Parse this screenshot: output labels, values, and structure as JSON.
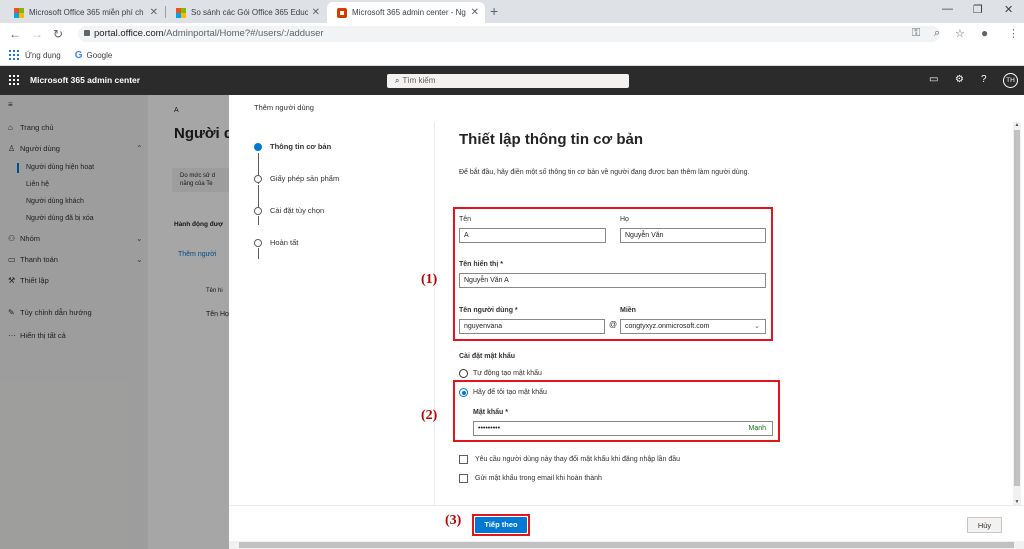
{
  "browser": {
    "tabs": [
      {
        "title": "Microsoft Office 365 miễn phí ch"
      },
      {
        "title": "So sánh các Gói Office 365 Educa"
      },
      {
        "title": "Microsoft 365 admin center - Ng"
      }
    ],
    "url_host": "portal.office.com",
    "url_path": "/Adminportal/Home?#/users/:/adduser",
    "bookmarks": [
      "Ứng dụng",
      "Google"
    ]
  },
  "header": {
    "app_title": "Microsoft 365 admin center",
    "search_placeholder": "Tìm kiếm",
    "avatar_initials": "TH"
  },
  "leftnav": {
    "items": [
      {
        "label": "Trang chủ",
        "icon": "home-icon"
      },
      {
        "label": "Người dùng",
        "icon": "person-icon"
      },
      {
        "label": "Nhóm",
        "icon": "group-icon"
      },
      {
        "label": "Thanh toán",
        "icon": "billing-icon"
      },
      {
        "label": "Thiết lập",
        "icon": "wrench-icon"
      },
      {
        "label": "Tùy chỉnh dẫn hướng",
        "icon": "pencil-icon"
      },
      {
        "label": "Hiển thị tất cả",
        "icon": "ellipsis-icon"
      }
    ],
    "user_subitems": [
      "Người dùng hiện hoạt",
      "Liên hệ",
      "Người dùng khách",
      "Người dùng đã bị xóa"
    ]
  },
  "background": {
    "breadcrumb": "A",
    "page_title": "Người d",
    "notice": "Do mức sử d",
    "notice2": "năng của Te",
    "actions_label": "Hành động đượ",
    "add_user": "Thêm người",
    "col1": "Tên hi",
    "col2": "Tên Họ"
  },
  "panel": {
    "title": "Thêm người dùng",
    "steps": [
      "Thông tin cơ bản",
      "Giấy phép sản phẩm",
      "Cài đặt tùy chọn",
      "Hoàn tất"
    ],
    "heading": "Thiết lập thông tin cơ bản",
    "intro": "Để bắt đầu, hãy điền một số thông tin cơ bản về người đang được bạn thêm làm người dùng.",
    "first_name_label": "Tên",
    "first_name_value": "A",
    "last_name_label": "Họ",
    "last_name_value": "Nguyễn Văn",
    "display_name_label": "Tên hiển thị *",
    "display_name_value": "Nguyễn Văn A",
    "username_label": "Tên người dùng *",
    "username_value": "nguyenvana",
    "at_sign": "@",
    "domain_label": "Miền",
    "domain_value": "congtyxyz.onmicrosoft.com",
    "password_settings_label": "Cài đặt mật khẩu",
    "auto_password_label": "Tự động tạo mật khẩu",
    "manual_password_label": "Hãy để tôi tạo mật khẩu",
    "password_label": "Mật khẩu *",
    "password_value": "•••••••••",
    "password_strength": "Mạnh",
    "require_change_label": "Yêu cầu người dùng này thay đổi mật khẩu khi đăng nhập lần đầu",
    "email_password_label": "Gửi mật khẩu trong email khi hoàn thành",
    "next_button": "Tiếp theo",
    "cancel_button": "Hủy"
  },
  "annotations": [
    "(1)",
    "(2)",
    "(3)"
  ],
  "colors": {
    "accent": "#0078d4",
    "annotation": "#e3141c",
    "header": "#2b2b2b"
  }
}
